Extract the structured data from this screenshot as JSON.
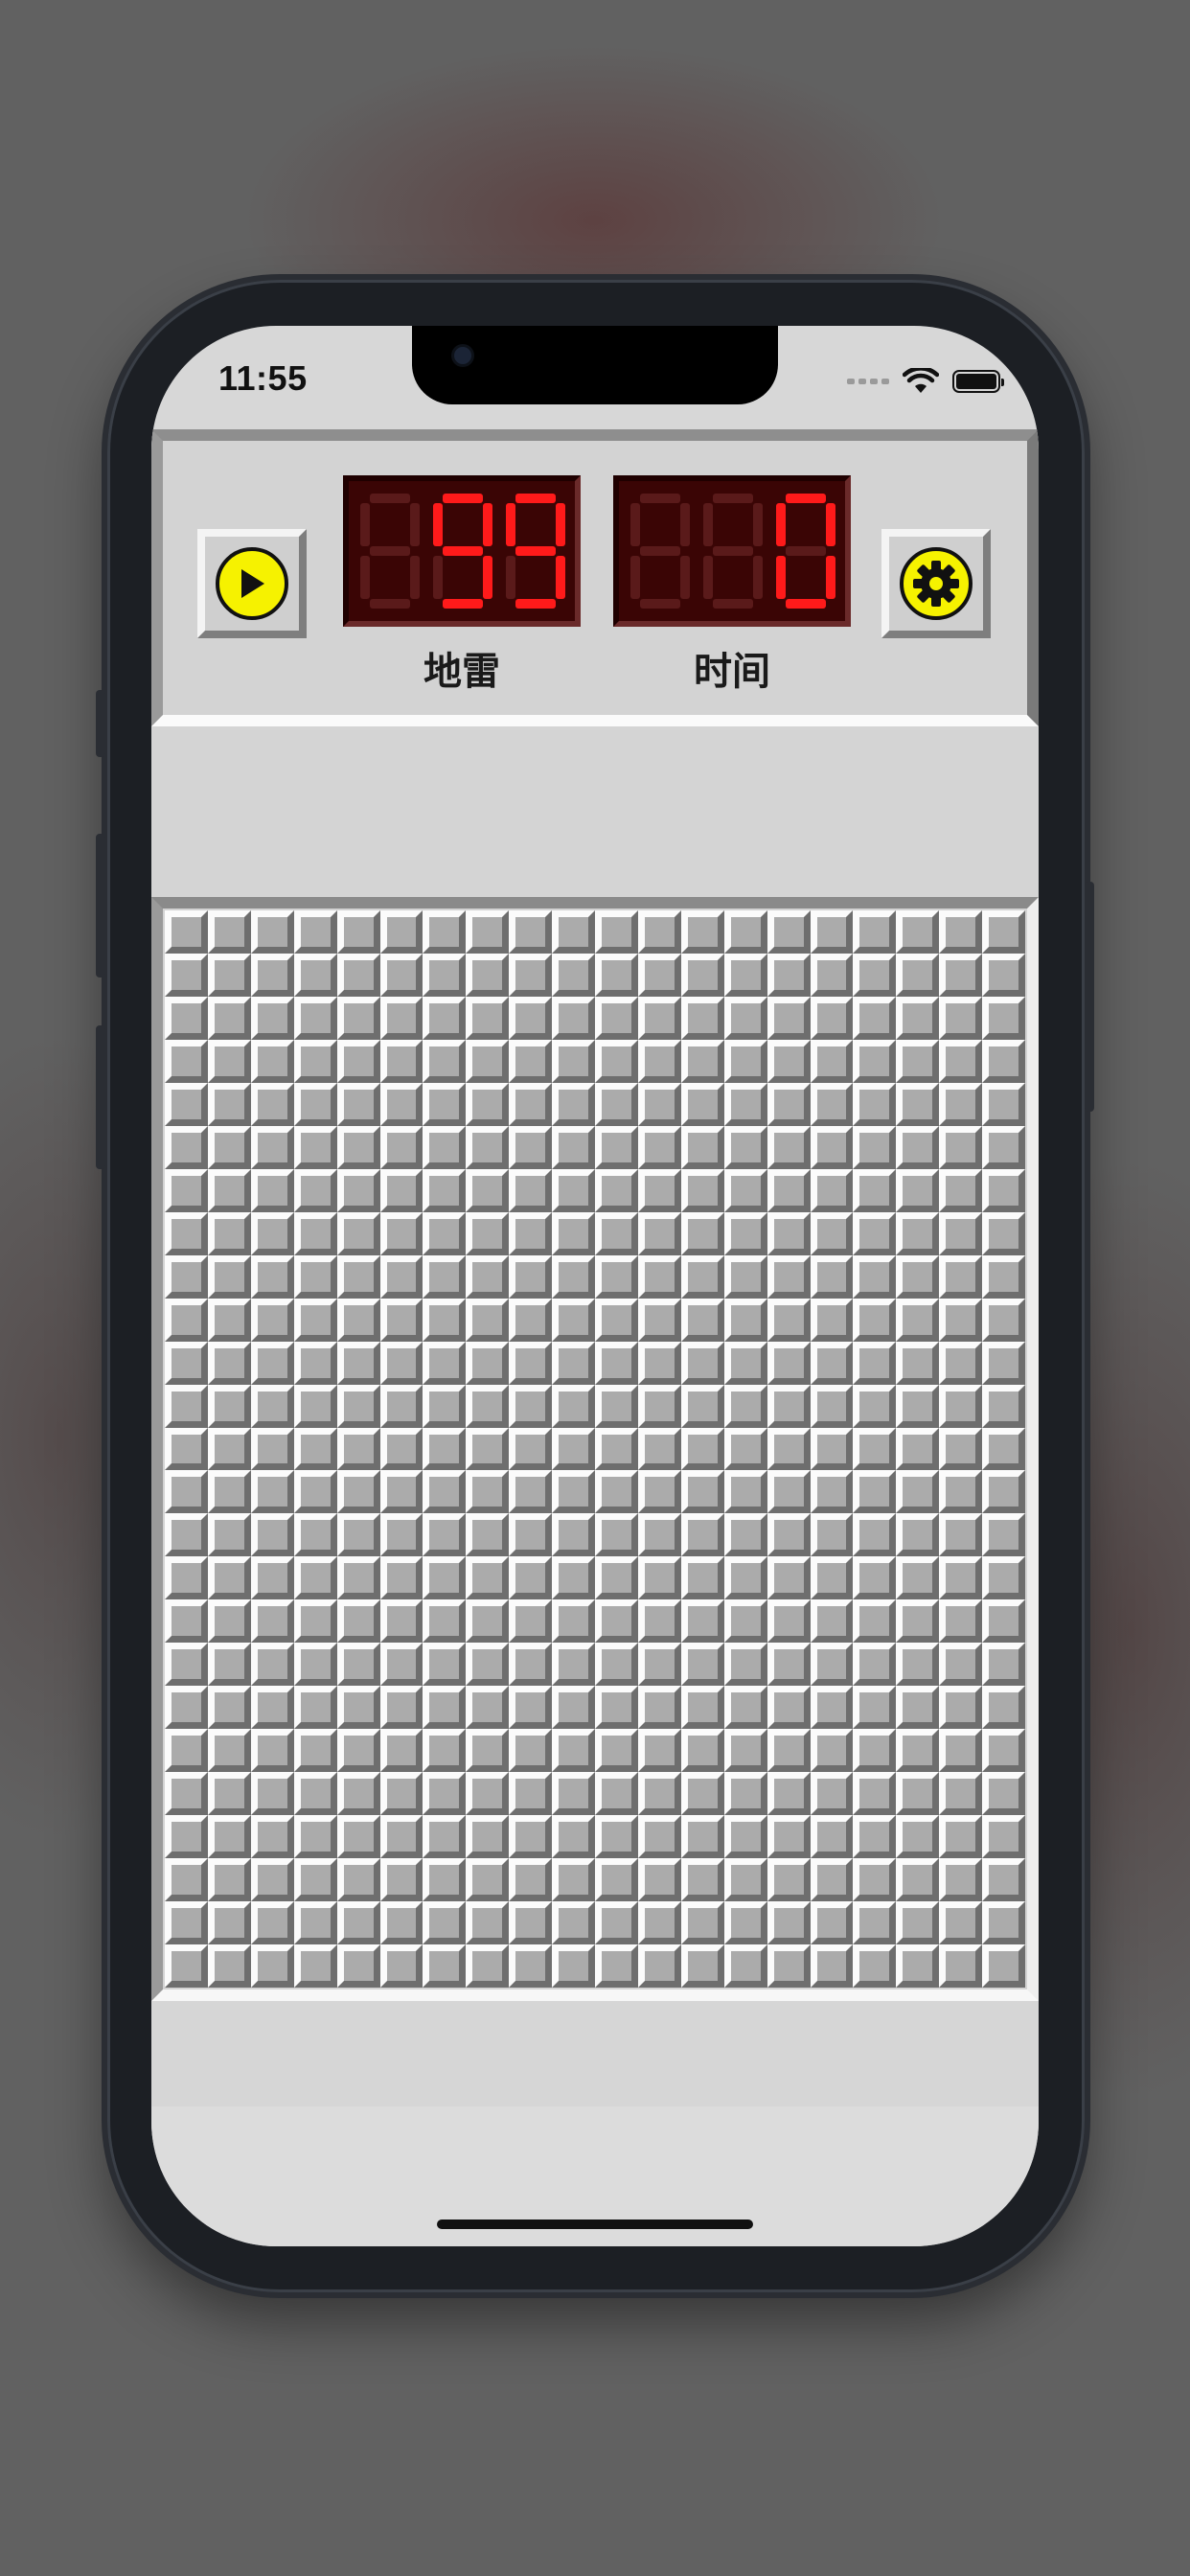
{
  "status_bar": {
    "time": "11:55"
  },
  "counters": {
    "mines": {
      "value": "99",
      "label": "地雷"
    },
    "time": {
      "value": "0",
      "label": "时间"
    }
  },
  "icons": {
    "play": "play-icon",
    "settings": "gear-icon"
  },
  "board": {
    "columns": 20,
    "rows": 25,
    "state": "all-unrevealed"
  },
  "colors": {
    "lcd_on": "#ff1a1a",
    "lcd_off": "#5a1a1a",
    "button_yellow": "#f6f200",
    "tile": "#ababab"
  }
}
